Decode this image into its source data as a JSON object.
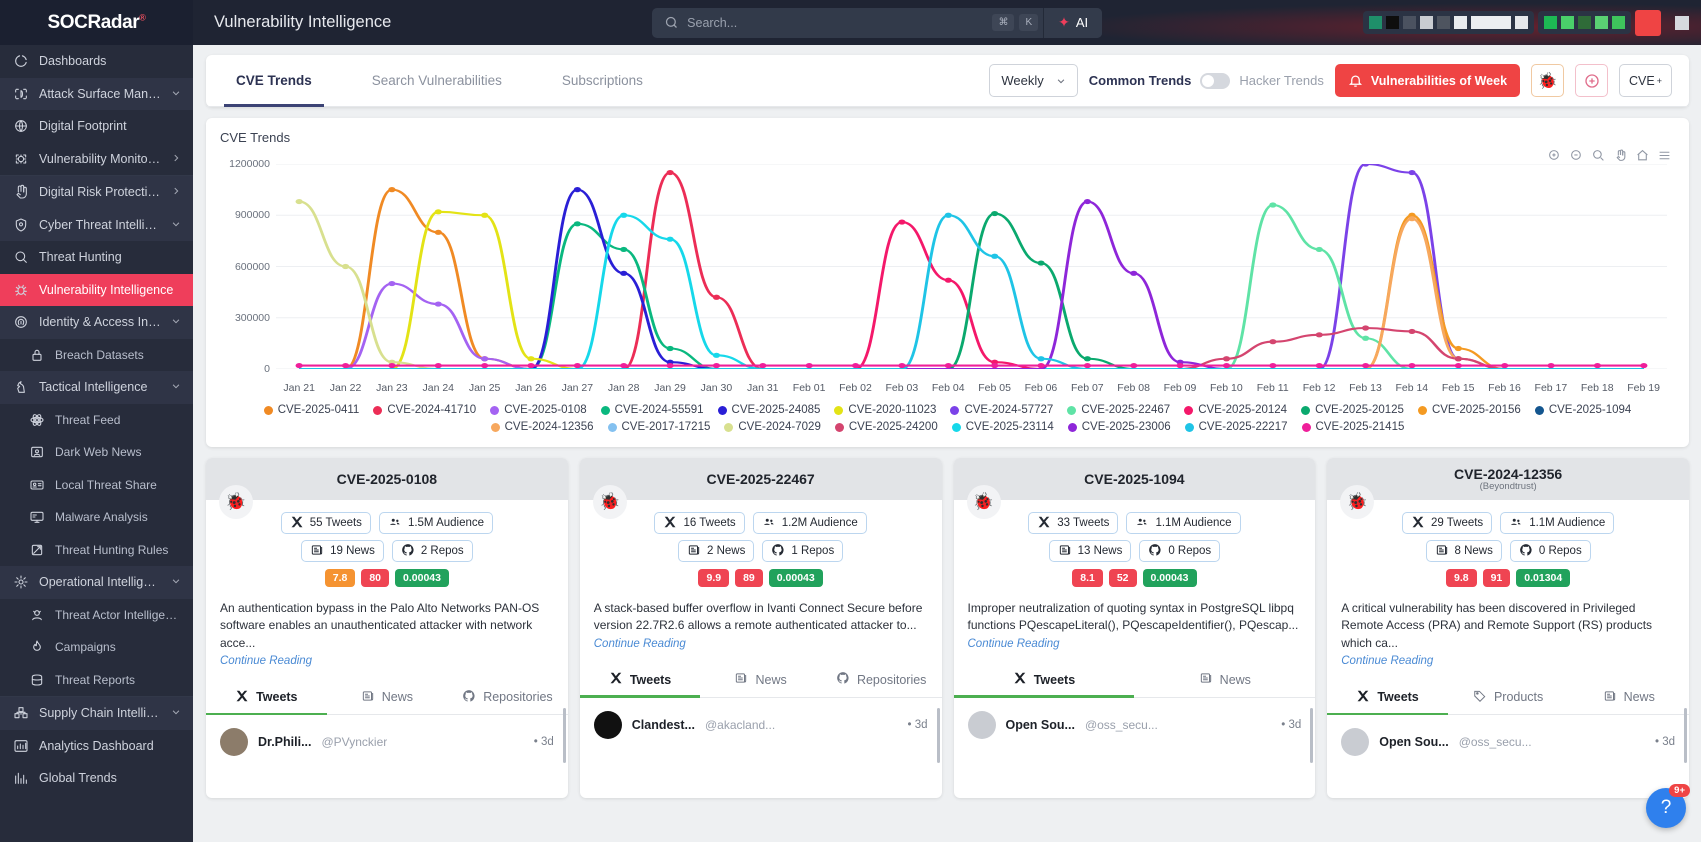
{
  "brand": {
    "name": "SOCRadar",
    "reg": "®"
  },
  "header": {
    "page_title": "Vulnerability Intelligence",
    "search_placeholder": "Search...",
    "search_value": "",
    "kbd_cmd": "⌘",
    "kbd_key": "K",
    "ai_label": "AI"
  },
  "sidebar": {
    "items": [
      {
        "label": "Dashboards",
        "icon": "dashboard-icon",
        "type": "item",
        "active": false
      },
      {
        "label": "Attack Surface Management",
        "icon": "shield-target-icon",
        "type": "group",
        "chevron": "down"
      },
      {
        "label": "Digital Footprint",
        "icon": "globe-icon",
        "type": "item"
      },
      {
        "label": "Vulnerability Monitoring",
        "icon": "bug-scan-icon",
        "type": "item",
        "chevron": "right"
      },
      {
        "label": "Digital Risk Protection",
        "icon": "hand-icon",
        "type": "group",
        "chevron": "right"
      },
      {
        "label": "Cyber Threat Intelligence",
        "icon": "eye-shield-icon",
        "type": "group",
        "chevron": "down"
      },
      {
        "label": "Threat Hunting",
        "icon": "search-icon",
        "type": "item"
      },
      {
        "label": "Vulnerability Intelligence",
        "icon": "bug-icon",
        "type": "item",
        "active": true
      },
      {
        "label": "Identity & Access Intelligence",
        "icon": "fingerprint-icon",
        "type": "group",
        "chevron": "down"
      },
      {
        "label": "Breach Datasets",
        "icon": "lock-icon",
        "type": "sub"
      },
      {
        "label": "Tactical Intelligence",
        "icon": "chess-knight-icon",
        "type": "group",
        "chevron": "down"
      },
      {
        "label": "Threat Feed",
        "icon": "atom-icon",
        "type": "sub"
      },
      {
        "label": "Dark Web News",
        "icon": "darkweb-icon",
        "type": "sub"
      },
      {
        "label": "Local Threat Share",
        "icon": "card-icon",
        "type": "sub"
      },
      {
        "label": "Malware Analysis",
        "icon": "monitor-icon",
        "type": "sub"
      },
      {
        "label": "Threat Hunting Rules",
        "icon": "rules-icon",
        "type": "sub"
      },
      {
        "label": "Operational Intelligence",
        "icon": "gear-node-icon",
        "type": "group",
        "chevron": "down"
      },
      {
        "label": "Threat Actor Intelligence",
        "icon": "actor-icon",
        "type": "sub"
      },
      {
        "label": "Campaigns",
        "icon": "flame-icon",
        "type": "sub"
      },
      {
        "label": "Threat Reports",
        "icon": "reports-icon",
        "type": "sub"
      },
      {
        "label": "Supply Chain Intelligence",
        "icon": "supplychain-icon",
        "type": "group",
        "chevron": "down"
      },
      {
        "label": "Analytics Dashboard",
        "icon": "analytics-icon",
        "type": "item"
      },
      {
        "label": "Global Trends",
        "icon": "trends-icon",
        "type": "item"
      }
    ]
  },
  "tabs": [
    {
      "label": "CVE Trends",
      "active": true
    },
    {
      "label": "Search Vulnerabilities",
      "active": false
    },
    {
      "label": "Subscriptions",
      "active": false
    }
  ],
  "toolbar": {
    "period_value": "Weekly",
    "common_trends_label": "Common Trends",
    "hacker_trends_label": "Hacker Trends",
    "vuln_of_week_label": "Vulnerabilities of Week",
    "bug_button_icon": "bug-icon",
    "add_button_icon": "plus-circle-icon",
    "cve_button_label": "CVE",
    "cve_button_sup": "+"
  },
  "chart_data": {
    "type": "line",
    "title": "CVE Trends",
    "xlabel": "",
    "ylabel": "",
    "ylim": [
      0,
      1200000
    ],
    "yticks": [
      0,
      300000,
      600000,
      900000,
      1200000
    ],
    "grid": true,
    "legend_position": "bottom",
    "categories": [
      "Jan 21",
      "Jan 22",
      "Jan 23",
      "Jan 24",
      "Jan 25",
      "Jan 26",
      "Jan 27",
      "Jan 28",
      "Jan 29",
      "Jan 30",
      "Jan 31",
      "Feb 01",
      "Feb 02",
      "Feb 03",
      "Feb 04",
      "Feb 05",
      "Feb 06",
      "Feb 07",
      "Feb 08",
      "Feb 09",
      "Feb 10",
      "Feb 11",
      "Feb 12",
      "Feb 13",
      "Feb 14",
      "Feb 15",
      "Feb 16",
      "Feb 17",
      "Feb 18",
      "Feb 19"
    ],
    "series": [
      {
        "name": "CVE-2025-0411",
        "color": "#f08a24",
        "values": [
          0,
          0,
          1050000,
          800000,
          60000,
          0,
          0,
          0,
          0,
          0,
          0,
          0,
          0,
          0,
          0,
          0,
          0,
          0,
          0,
          0,
          0,
          0,
          0,
          0,
          0,
          0,
          0,
          0,
          0,
          0
        ]
      },
      {
        "name": "CVE-2024-41710",
        "color": "#ec2d56",
        "values": [
          0,
          0,
          0,
          0,
          0,
          0,
          0,
          0,
          1150000,
          420000,
          0,
          0,
          0,
          0,
          0,
          0,
          0,
          0,
          0,
          0,
          0,
          0,
          0,
          0,
          0,
          0,
          0,
          0,
          0,
          0
        ]
      },
      {
        "name": "CVE-2025-0108",
        "color": "#a463f2",
        "values": [
          0,
          0,
          500000,
          380000,
          60000,
          0,
          0,
          0,
          0,
          0,
          0,
          0,
          0,
          0,
          0,
          0,
          0,
          0,
          0,
          0,
          0,
          0,
          0,
          0,
          0,
          0,
          0,
          0,
          0,
          0
        ]
      },
      {
        "name": "CVE-2024-55591",
        "color": "#0ab87f",
        "values": [
          0,
          0,
          0,
          0,
          0,
          0,
          850000,
          700000,
          120000,
          0,
          0,
          0,
          0,
          0,
          0,
          0,
          0,
          0,
          0,
          0,
          0,
          0,
          0,
          0,
          0,
          0,
          0,
          0,
          0,
          0
        ]
      },
      {
        "name": "CVE-2025-24085",
        "color": "#2a1fd6",
        "values": [
          0,
          0,
          0,
          0,
          0,
          0,
          1050000,
          560000,
          40000,
          0,
          0,
          0,
          0,
          0,
          0,
          0,
          0,
          0,
          0,
          0,
          0,
          0,
          0,
          0,
          0,
          0,
          0,
          0,
          0,
          0
        ]
      },
      {
        "name": "CVE-2020-11023",
        "color": "#e3e316",
        "values": [
          0,
          0,
          0,
          920000,
          900000,
          60000,
          0,
          0,
          0,
          0,
          0,
          0,
          0,
          0,
          0,
          0,
          0,
          0,
          0,
          0,
          0,
          0,
          0,
          0,
          0,
          0,
          0,
          0,
          0,
          0
        ]
      },
      {
        "name": "CVE-2024-57727",
        "color": "#7b42e8",
        "values": [
          0,
          0,
          0,
          0,
          0,
          0,
          0,
          0,
          0,
          0,
          0,
          0,
          0,
          0,
          0,
          0,
          0,
          0,
          0,
          0,
          0,
          0,
          0,
          1200000,
          1150000,
          60000,
          0,
          0,
          0,
          0
        ]
      },
      {
        "name": "CVE-2025-22467",
        "color": "#5fe3a6",
        "values": [
          0,
          0,
          0,
          0,
          0,
          0,
          0,
          0,
          0,
          0,
          0,
          0,
          0,
          0,
          0,
          0,
          0,
          0,
          0,
          0,
          0,
          960000,
          700000,
          180000,
          0,
          0,
          0,
          0,
          0,
          0
        ]
      },
      {
        "name": "CVE-2025-20124",
        "color": "#f4186a",
        "values": [
          0,
          0,
          0,
          0,
          0,
          0,
          0,
          0,
          0,
          0,
          0,
          0,
          0,
          860000,
          520000,
          40000,
          0,
          0,
          0,
          0,
          0,
          0,
          0,
          0,
          0,
          0,
          0,
          0,
          0,
          0
        ]
      },
      {
        "name": "CVE-2025-20125",
        "color": "#0aa96e",
        "values": [
          0,
          0,
          0,
          0,
          0,
          0,
          0,
          0,
          0,
          0,
          0,
          0,
          0,
          0,
          0,
          910000,
          620000,
          60000,
          0,
          0,
          0,
          0,
          0,
          0,
          0,
          0,
          0,
          0,
          0,
          0
        ]
      },
      {
        "name": "CVE-2025-20156",
        "color": "#f49a22",
        "values": [
          0,
          0,
          0,
          0,
          0,
          0,
          0,
          0,
          0,
          0,
          0,
          0,
          0,
          0,
          0,
          0,
          0,
          0,
          0,
          0,
          0,
          0,
          0,
          0,
          900000,
          120000,
          0,
          0,
          0,
          0
        ]
      },
      {
        "name": "CVE-2025-1094",
        "color": "#14568f",
        "values": [
          0,
          0,
          0,
          0,
          0,
          0,
          0,
          0,
          0,
          0,
          0,
          0,
          0,
          0,
          0,
          0,
          0,
          0,
          0,
          0,
          0,
          0,
          0,
          0,
          0,
          0,
          0,
          0,
          0,
          0
        ]
      },
      {
        "name": "CVE-2024-12356",
        "color": "#f7a85e",
        "values": [
          0,
          0,
          0,
          0,
          0,
          0,
          0,
          0,
          0,
          0,
          0,
          0,
          0,
          0,
          0,
          0,
          0,
          0,
          0,
          0,
          0,
          0,
          0,
          0,
          880000,
          60000,
          0,
          0,
          0,
          0
        ]
      },
      {
        "name": "CVE-2017-17215",
        "color": "#84c1f0",
        "values": [
          0,
          0,
          0,
          0,
          0,
          0,
          0,
          0,
          0,
          0,
          0,
          0,
          0,
          0,
          0,
          0,
          0,
          0,
          0,
          0,
          0,
          0,
          0,
          0,
          0,
          0,
          0,
          0,
          0,
          0
        ]
      },
      {
        "name": "CVE-2024-7029",
        "color": "#d8e08f",
        "values": [
          980000,
          600000,
          40000,
          0,
          0,
          0,
          0,
          0,
          0,
          0,
          0,
          0,
          0,
          0,
          0,
          0,
          0,
          0,
          0,
          0,
          0,
          0,
          0,
          0,
          0,
          0,
          0,
          0,
          0,
          0
        ]
      },
      {
        "name": "CVE-2025-24200",
        "color": "#d4456f",
        "values": [
          0,
          0,
          0,
          0,
          0,
          0,
          0,
          0,
          0,
          0,
          0,
          0,
          0,
          0,
          0,
          0,
          0,
          0,
          0,
          0,
          60000,
          160000,
          200000,
          240000,
          220000,
          60000,
          0,
          0,
          0,
          0
        ]
      },
      {
        "name": "CVE-2025-23114",
        "color": "#16d8ea",
        "values": [
          0,
          0,
          0,
          0,
          0,
          0,
          0,
          900000,
          760000,
          80000,
          0,
          0,
          0,
          0,
          0,
          0,
          0,
          0,
          0,
          0,
          0,
          0,
          0,
          0,
          0,
          0,
          0,
          0,
          0,
          0
        ]
      },
      {
        "name": "CVE-2025-23006",
        "color": "#8e26d9",
        "values": [
          0,
          0,
          0,
          0,
          0,
          0,
          0,
          0,
          0,
          0,
          0,
          0,
          0,
          0,
          0,
          0,
          0,
          980000,
          560000,
          40000,
          0,
          0,
          0,
          0,
          0,
          0,
          0,
          0,
          0,
          0
        ]
      },
      {
        "name": "CVE-2025-22217",
        "color": "#1fc4e6",
        "values": [
          0,
          0,
          0,
          0,
          0,
          0,
          0,
          0,
          0,
          0,
          0,
          0,
          0,
          0,
          900000,
          660000,
          60000,
          0,
          0,
          0,
          0,
          0,
          0,
          0,
          0,
          0,
          0,
          0,
          0,
          0
        ]
      },
      {
        "name": "CVE-2025-21415",
        "color": "#ef1f9a",
        "values": [
          20000,
          20000,
          20000,
          20000,
          20000,
          20000,
          20000,
          20000,
          20000,
          20000,
          20000,
          20000,
          20000,
          20000,
          20000,
          20000,
          20000,
          20000,
          20000,
          20000,
          20000,
          20000,
          20000,
          20000,
          20000,
          20000,
          20000,
          20000,
          20000,
          20000
        ]
      }
    ]
  },
  "cve_cards": [
    {
      "id": "CVE-2025-0108",
      "vendor": "",
      "bug_color": "#f5a623",
      "tweets": "55 Tweets",
      "audience": "1.5M Audience",
      "news": "19 News",
      "repos": "2 Repos",
      "scores": [
        {
          "value": "7.8",
          "color": "#f59331"
        },
        {
          "value": "80",
          "color": "#ef4452"
        },
        {
          "value": "0.00043",
          "color": "#21a25c"
        }
      ],
      "description": "An authentication bypass in the Palo Alto Networks PAN-OS software enables an unauthenticated attacker with network acce...",
      "continue_label": "Continue Reading",
      "tabs": [
        {
          "label": "Tweets",
          "icon": "x-icon",
          "active": true
        },
        {
          "label": "News",
          "icon": "news-icon",
          "active": false
        },
        {
          "label": "Repositories",
          "icon": "github-icon",
          "active": false
        }
      ],
      "tweet": {
        "name": "Dr.Phili...",
        "handle": "@PVynckier",
        "age": "3d",
        "avatar_color": "#8c7c6a"
      }
    },
    {
      "id": "CVE-2025-22467",
      "vendor": "",
      "bug_color": "#f5a623",
      "tweets": "16 Tweets",
      "audience": "1.2M Audience",
      "news": "2 News",
      "repos": "1 Repos",
      "scores": [
        {
          "value": "9.9",
          "color": "#ef4452"
        },
        {
          "value": "89",
          "color": "#ef4452"
        },
        {
          "value": "0.00043",
          "color": "#21a25c"
        }
      ],
      "description": "A stack-based buffer overflow in Ivanti Connect Secure before version 22.7R2.6 allows a remote authenticated attacker to...",
      "continue_label": "Continue Reading",
      "tabs": [
        {
          "label": "Tweets",
          "icon": "x-icon",
          "active": true
        },
        {
          "label": "News",
          "icon": "news-icon",
          "active": false
        },
        {
          "label": "Repositories",
          "icon": "github-icon",
          "active": false
        }
      ],
      "tweet": {
        "name": "Clandest...",
        "handle": "@akacland...",
        "age": "3d",
        "avatar_color": "#111111"
      }
    },
    {
      "id": "CVE-2025-1094",
      "vendor": "",
      "bug_color": "#6b6f78",
      "tweets": "33 Tweets",
      "audience": "1.1M Audience",
      "news": "13 News",
      "repos": "0 Repos",
      "scores": [
        {
          "value": "8.1",
          "color": "#ef4452"
        },
        {
          "value": "52",
          "color": "#ef4452"
        },
        {
          "value": "0.00043",
          "color": "#21a25c"
        }
      ],
      "description": "Improper neutralization of quoting syntax in PostgreSQL libpq functions PQescapeLiteral(), PQescapeIdentifier(), PQescap...",
      "continue_label": "Continue Reading",
      "tabs": [
        {
          "label": "Tweets",
          "icon": "x-icon",
          "active": true
        },
        {
          "label": "News",
          "icon": "news-icon",
          "active": false
        }
      ],
      "tweet": {
        "name": "Open Sou...",
        "handle": "@oss_secu...",
        "age": "3d",
        "avatar_color": "#c9ccd2"
      }
    },
    {
      "id": "CVE-2024-12356",
      "vendor": "(Beyondtrust)",
      "bug_color": "#6b6f78",
      "tweets": "29 Tweets",
      "audience": "1.1M Audience",
      "news": "8 News",
      "repos": "0 Repos",
      "scores": [
        {
          "value": "9.8",
          "color": "#ef4452"
        },
        {
          "value": "91",
          "color": "#ef4452"
        },
        {
          "value": "0.01304",
          "color": "#21a25c"
        }
      ],
      "description": "A critical vulnerability has been discovered in Privileged Remote Access (PRA) and Remote Support (RS) products which ca...",
      "continue_label": "Continue Reading",
      "tabs": [
        {
          "label": "Tweets",
          "icon": "x-icon",
          "active": true
        },
        {
          "label": "Products",
          "icon": "tag-icon",
          "active": false
        },
        {
          "label": "News",
          "icon": "news-icon",
          "active": false
        }
      ],
      "tweet": {
        "name": "Open Sou...",
        "handle": "@oss_secu...",
        "age": "3d",
        "avatar_color": "#c9ccd2"
      }
    }
  ],
  "help": {
    "badge": "9+",
    "icon": "question-icon"
  },
  "colors": {
    "accent_red": "#ef3e5b",
    "brand_dark": "#272c3b",
    "tab_underline": "#3c4375",
    "green": "#4caf50"
  }
}
